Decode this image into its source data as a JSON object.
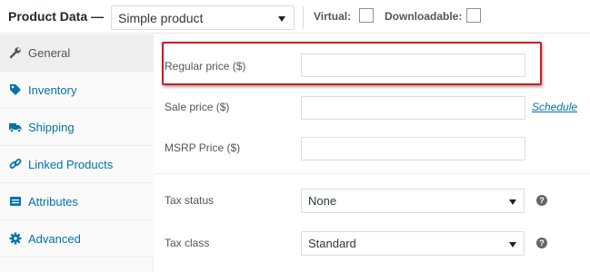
{
  "header": {
    "title": "Product Data —",
    "product_type": {
      "selected": "Simple product"
    },
    "virtual_label": "Virtual:",
    "downloadable_label": "Downloadable:"
  },
  "sidebar": {
    "items": [
      {
        "label": "General",
        "icon": "wrench-icon",
        "active": true
      },
      {
        "label": "Inventory",
        "icon": "tag-icon"
      },
      {
        "label": "Shipping",
        "icon": "truck-icon"
      },
      {
        "label": "Linked Products",
        "icon": "link-icon"
      },
      {
        "label": "Attributes",
        "icon": "list-icon"
      },
      {
        "label": "Advanced",
        "icon": "gear-icon"
      }
    ]
  },
  "general": {
    "regular_price": {
      "label": "Regular price ($)",
      "value": ""
    },
    "sale_price": {
      "label": "Sale price ($)",
      "value": "",
      "schedule_link": "Schedule"
    },
    "msrp_price": {
      "label": "MSRP Price ($)",
      "value": ""
    },
    "tax_status": {
      "label": "Tax status",
      "selected": "None"
    },
    "tax_class": {
      "label": "Tax class",
      "selected": "Standard"
    },
    "help_glyph": "?"
  },
  "colors": {
    "link": "#0073aa",
    "highlight_border": "#d0191e",
    "active_tab_bg": "#eeeeee"
  }
}
